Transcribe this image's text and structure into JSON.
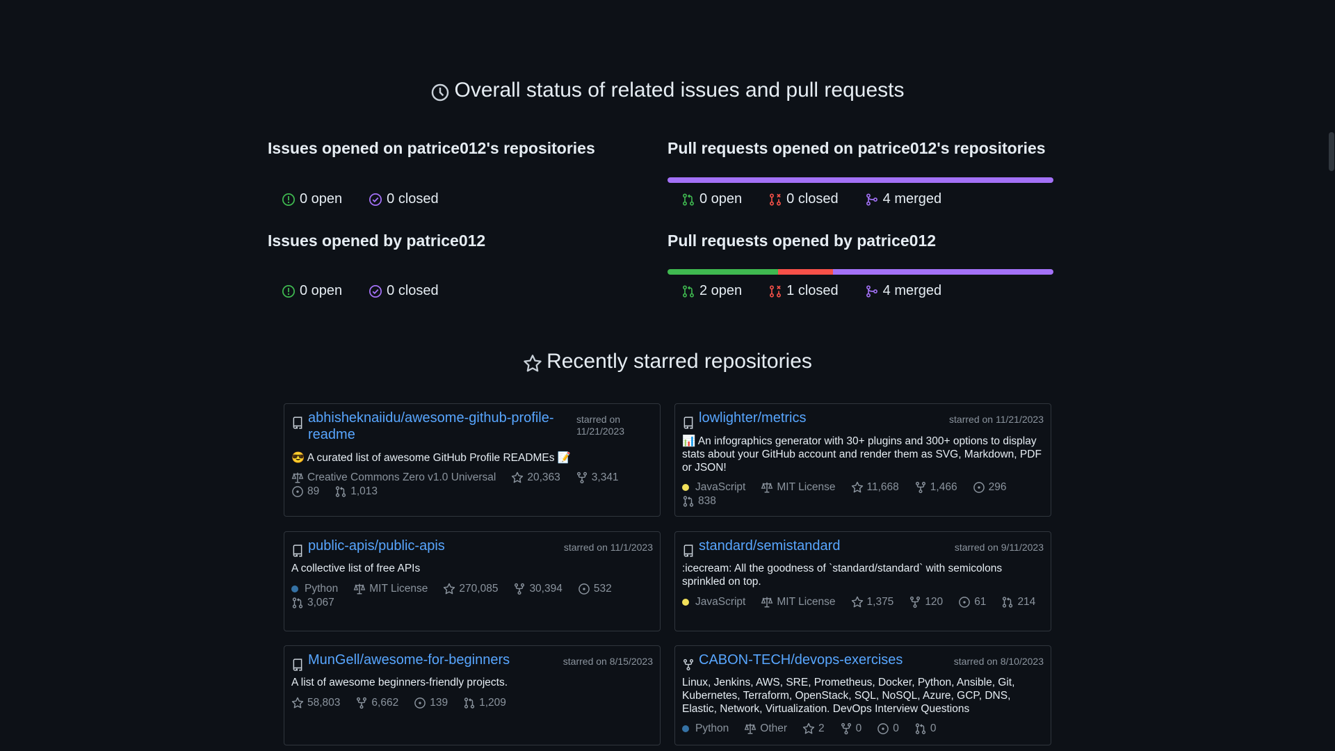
{
  "status_section": {
    "title": "Overall status of related issues and pull requests",
    "issues_on_repos": {
      "heading": "Issues opened on patrice012's repositories",
      "open": "0 open",
      "closed": "0 closed"
    },
    "prs_on_repos": {
      "heading": "Pull requests opened on patrice012's repositories",
      "open": "0 open",
      "closed": "0 closed",
      "merged": "4 merged",
      "bar": [
        0,
        0,
        4
      ]
    },
    "issues_by_user": {
      "heading": "Issues opened by patrice012",
      "open": "0 open",
      "closed": "0 closed"
    },
    "prs_by_user": {
      "heading": "Pull requests opened by patrice012",
      "open": "2 open",
      "closed": "1 closed",
      "merged": "4 merged",
      "bar": [
        2,
        1,
        4
      ]
    }
  },
  "colors": {
    "open": "#3fb950",
    "closed_pr": "#f85149",
    "merged": "#a371f7",
    "link": "#58a6ff",
    "python": "#3572A5",
    "javascript": "#f1e05a"
  },
  "starred_section": {
    "title": "Recently starred repositories",
    "repos": [
      {
        "name": "abhisheknaiidu/awesome-github-profile-readme",
        "starred": "starred on 11/21/2023",
        "description": "😎 A curated list of awesome GitHub Profile READMEs 📝",
        "license": "Creative Commons Zero v1.0 Universal",
        "stars": "20,363",
        "forks": "3,341",
        "issues": "89",
        "prs": "1,013",
        "icon": "repo-icon"
      },
      {
        "name": "lowlighter/metrics",
        "starred": "starred on 11/21/2023",
        "description": "📊 An infographics generator with 30+ plugins and 300+ options to display stats about your GitHub account and render them as SVG, Markdown, PDF or JSON!",
        "language": "JavaScript",
        "license": "MIT License",
        "stars": "11,668",
        "forks": "1,466",
        "issues": "296",
        "prs": "838",
        "icon": "repo-icon"
      },
      {
        "name": "public-apis/public-apis",
        "starred": "starred on 11/1/2023",
        "description": "A collective list of free APIs",
        "language": "Python",
        "license": "MIT License",
        "stars": "270,085",
        "forks": "30,394",
        "issues": "532",
        "prs": "3,067",
        "icon": "repo-icon"
      },
      {
        "name": "standard/semistandard",
        "starred": "starred on 9/11/2023",
        "description": ":icecream: All the goodness of `standard/standard` with semicolons sprinkled on top.",
        "language": "JavaScript",
        "license": "MIT License",
        "stars": "1,375",
        "forks": "120",
        "issues": "61",
        "prs": "214",
        "icon": "repo-icon"
      },
      {
        "name": "MunGell/awesome-for-beginners",
        "starred": "starred on 8/15/2023",
        "description": "A list of awesome beginners-friendly projects.",
        "stars": "58,803",
        "forks": "6,662",
        "issues": "139",
        "prs": "1,209",
        "icon": "repo-icon"
      },
      {
        "name": "CABON-TECH/devops-exercises",
        "starred": "starred on 8/10/2023",
        "description": "Linux, Jenkins, AWS, SRE, Prometheus, Docker, Python, Ansible, Git, Kubernetes, Terraform, OpenStack, SQL, NoSQL, Azure, GCP, DNS, Elastic, Network, Virtualization. DevOps Interview Questions",
        "language": "Python",
        "license": "Other",
        "stars": "2",
        "forks": "0",
        "issues": "0",
        "prs": "0",
        "icon": "fork-icon"
      }
    ]
  }
}
